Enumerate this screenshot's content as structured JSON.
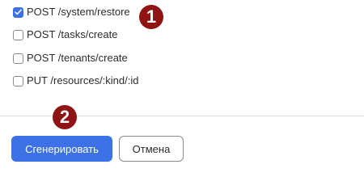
{
  "endpoints": [
    {
      "label": "POST /system/restore",
      "checked": true
    },
    {
      "label": "POST /tasks/create",
      "checked": false
    },
    {
      "label": "POST /tenants/create",
      "checked": false
    },
    {
      "label": "PUT /resources/:kind/:id",
      "checked": false
    }
  ],
  "actions": {
    "generate_label": "Сгенерировать",
    "cancel_label": "Отмена"
  },
  "annotations": {
    "marker_1": "1",
    "marker_2": "2"
  },
  "colors": {
    "accent": "#3c72e6",
    "marker": "#8f1414",
    "divider": "#dcdcdc"
  }
}
